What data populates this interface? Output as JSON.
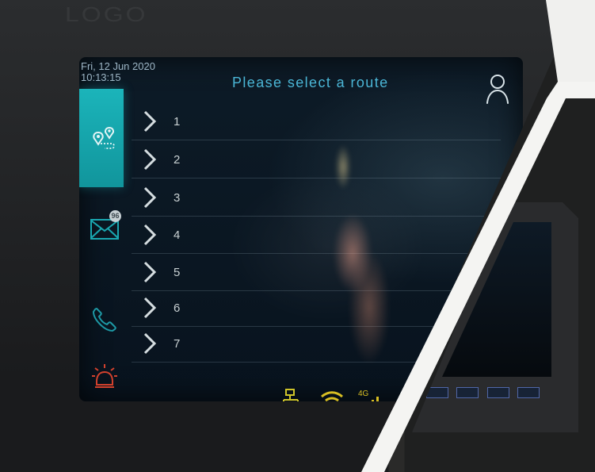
{
  "screen": {
    "date": "Fri, 12 Jun 2020",
    "time": "10:13:15",
    "title": "Please select a route",
    "message_badge": "96"
  },
  "routes": [
    {
      "label": "1"
    },
    {
      "label": "2"
    },
    {
      "label": "3"
    },
    {
      "label": "4"
    },
    {
      "label": "5"
    },
    {
      "label": "6"
    },
    {
      "label": "7"
    }
  ],
  "icons": {
    "profile": "user-icon",
    "route_map": "route-map-icon",
    "mail": "mail-icon",
    "phone": "phone-icon",
    "alarm": "alarm-icon",
    "network": "network-icon",
    "wifi": "wifi-icon",
    "cellular": "cellular-4g-icon"
  },
  "status": {
    "cellular_label": "4G"
  },
  "colors": {
    "accent": "#4bb6d6",
    "tile": "#14a7ae",
    "status_yellow": "#d6c425",
    "alarm_red": "#d2412d"
  },
  "camera_buttons": [
    "",
    "",
    "",
    ""
  ]
}
